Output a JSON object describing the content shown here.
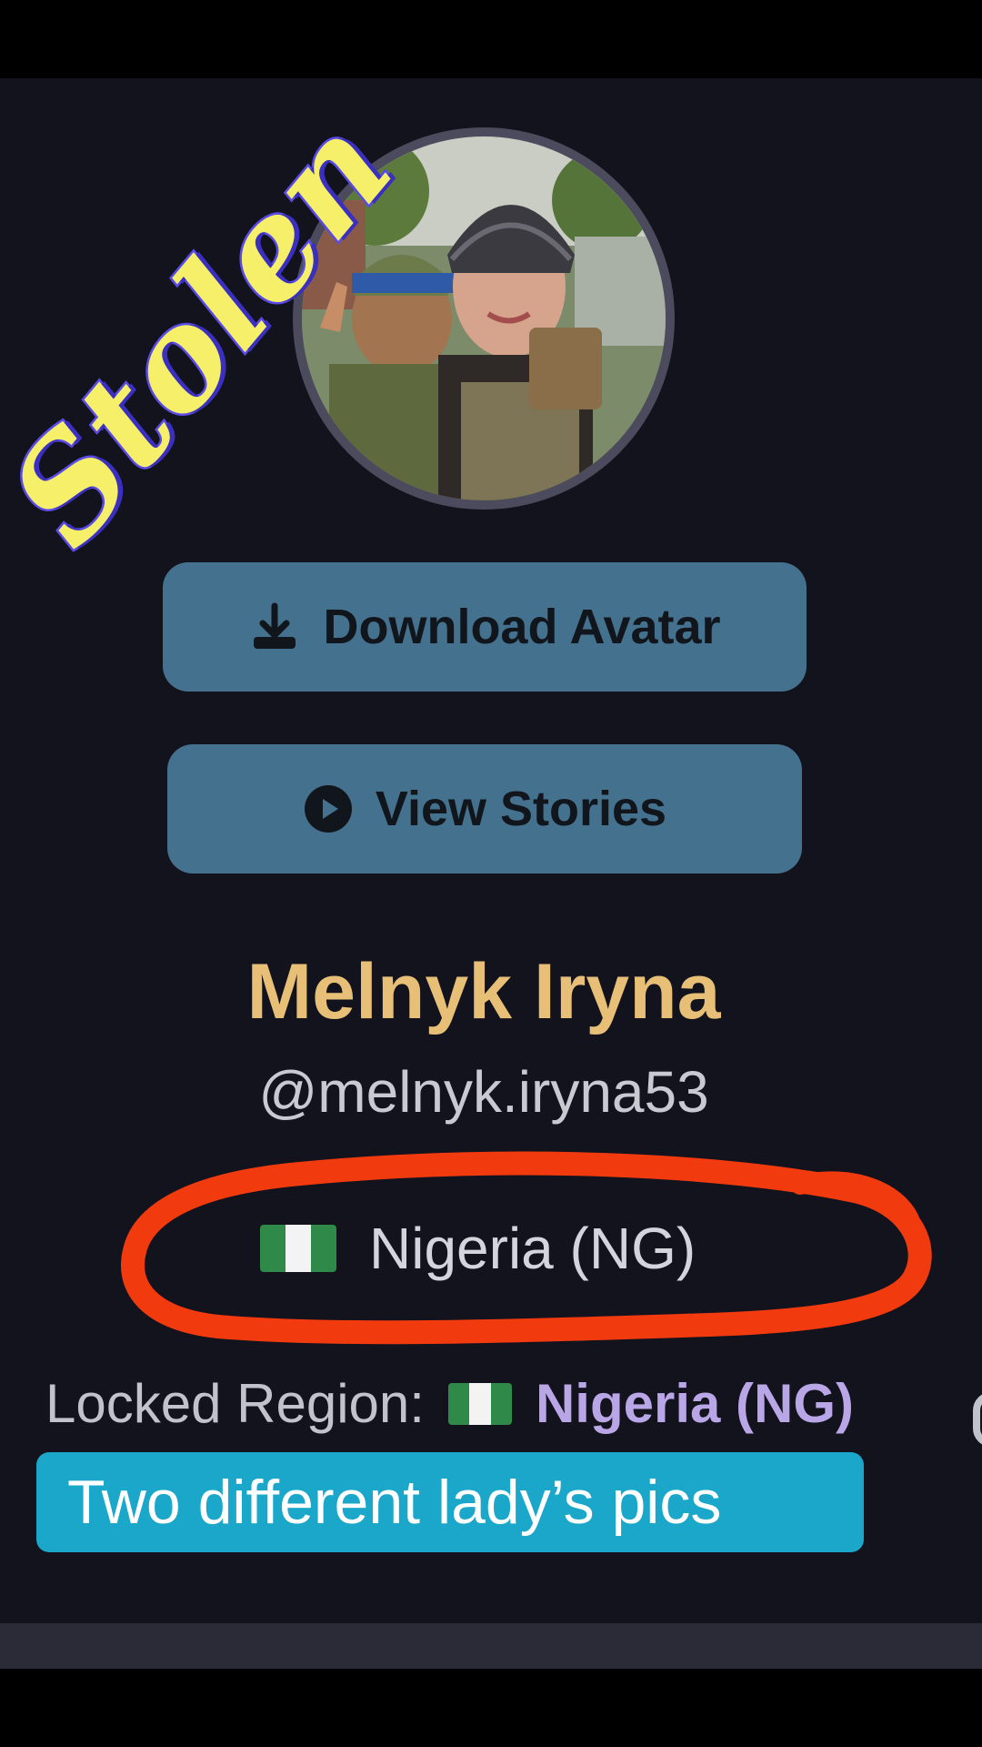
{
  "overlay": {
    "stolen_text": "Stolen",
    "caption": "Two different lady’s pics"
  },
  "profile": {
    "avatar_icon": "profile-photo",
    "download_button": {
      "label": "Download Avatar",
      "icon": "download-icon"
    },
    "stories_button": {
      "label": "View Stories",
      "icon": "play-circle-icon"
    },
    "name": "Melnyk Iryna",
    "handle": "@melnyk.iryna53",
    "country": {
      "flag": "nigeria-flag",
      "label": "Nigeria (NG)"
    },
    "locked_region": {
      "label": "Locked Region:",
      "flag": "nigeria-flag",
      "value": "Nigeria (NG)"
    }
  },
  "colors": {
    "background": "#13131e",
    "button_bg": "#44718e",
    "name": "#e7bf76",
    "locked_value": "#b9a6e6",
    "annotation_red": "#f23a0f",
    "caption_bg": "#1aa7c9",
    "stolen_fill": "#f6ef6a",
    "stolen_outline": "#5a4be8"
  }
}
